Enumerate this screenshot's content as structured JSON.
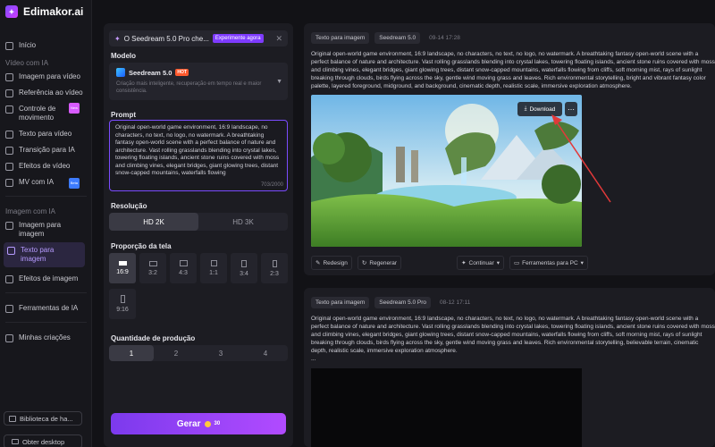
{
  "app": {
    "name": "Edimakor.ai"
  },
  "sidebar": {
    "items": [
      {
        "label": "Início"
      },
      {
        "section": "Vídeo com IA"
      },
      {
        "label": "Imagem para vídeo"
      },
      {
        "label": "Referência ao vídeo"
      },
      {
        "label": "Controle de movimento",
        "badge": "New"
      },
      {
        "label": "Texto para vídeo"
      },
      {
        "label": "Transição para IA"
      },
      {
        "label": "Efeitos de vídeo"
      },
      {
        "label": "MV com IA",
        "badge": "Beta"
      },
      {
        "section": "Imagem com IA"
      },
      {
        "label": "Imagem para imagem"
      },
      {
        "label": "Texto para imagem",
        "active": true
      },
      {
        "label": "Efeitos de imagem"
      },
      {
        "label": "Ferramentas de IA"
      },
      {
        "label": "Minhas criações"
      }
    ],
    "library_label": "Biblioteca de ha...",
    "desktop_label": "Obter desktop"
  },
  "config": {
    "banner_text": "O Seedream 5.0 Pro che...",
    "banner_tag": "Experimente agora",
    "model_label": "Modelo",
    "model_name": "Seedream 5.0",
    "model_hot": "HOT",
    "model_desc": "Criação mais inteligente, recuperação em tempo real e maior consistência.",
    "prompt_label": "Prompt",
    "prompt_text": "Original open-world game environment, 16:9 landscape, no characters, no text, no logo, no watermark. A breathtaking fantasy open-world scene with a perfect balance of nature and architecture. Vast rolling grasslands blending into crystal lakes, towering floating islands, ancient stone ruins covered with moss and climbing vines, elegant bridges, giant glowing trees, distant snow-capped mountains, waterfalls flowing",
    "prompt_count": "703/2000",
    "resolution_label": "Resolução",
    "resolution_options": [
      "HD 2K",
      "HD 3K"
    ],
    "ratio_label": "Proporção da tela",
    "ratios": [
      "16:9",
      "3:2",
      "4:3",
      "1:1",
      "3:4",
      "2:3",
      "9:16"
    ],
    "quantity_label": "Quantidade de produção",
    "quantities": [
      "1",
      "2",
      "3",
      "4"
    ],
    "generate_label": "Gerar",
    "generate_cost": "30"
  },
  "results": [
    {
      "tags": [
        "Texto para imagem",
        "Seedream 5.0"
      ],
      "date": "09-14 17:28",
      "description": "Original open-world game environment, 16:9 landscape, no characters, no text, no logo, no watermark. A breathtaking fantasy open-world scene with a perfect balance of nature and architecture. Vast rolling grasslands blending into crystal lakes, towering floating islands, ancient stone ruins covered with moss and climbing vines, elegant bridges, giant glowing trees, distant snow-capped mountains, waterfalls flowing from cliffs, soft morning mist, rays of sunlight breaking through clouds, birds flying across the sky, gentle wind moving grass and leaves. Rich environmental storytelling, bright and vibrant fantasy color palette, layered foreground, midground, and background, cinematic depth, realistic scale, immersive exploration atmosphere.",
      "download_label": "Download",
      "actions": {
        "redraw": "Redesign",
        "regenerate": "Regenerar",
        "continue": "Continuar",
        "pc_tools": "Ferramentas para PC"
      }
    },
    {
      "tags": [
        "Texto para imagem",
        "Seedream 5.0 Pro"
      ],
      "date": "08-12 17:11",
      "description": "Original open-world game environment, 16:9 landscape, no characters, no text, no logo, no watermark. A breathtaking fantasy open-world scene with a perfect balance of nature and architecture. Vast rolling grasslands blending into crystal lakes, towering floating islands, ancient stone ruins covered with moss and climbing vines, elegant bridges, giant glowing trees, distant snow-capped mountains, waterfalls flowing from cliffs, soft morning mist, rays of sunlight breaking through clouds, birds flying across the sky, gentle wind moving grass and leaves. Rich environmental storytelling, believable terrain, cinematic depth, realistic scale, immersive exploration atmosphere.",
      "ellipsis": "..."
    }
  ]
}
